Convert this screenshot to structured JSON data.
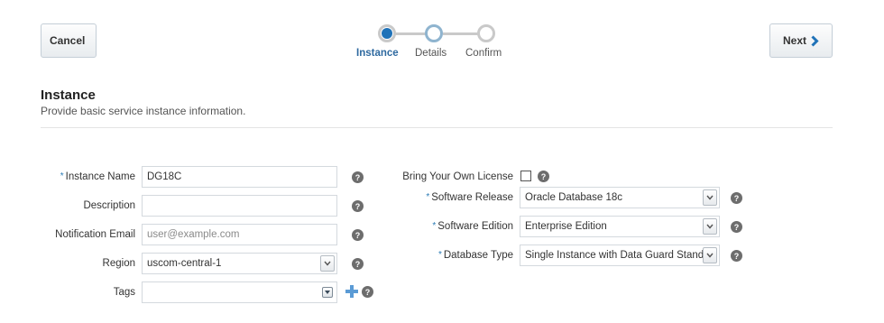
{
  "header": {
    "cancel_label": "Cancel",
    "next_label": "Next"
  },
  "train": {
    "steps": [
      {
        "label": "Instance",
        "state": "current"
      },
      {
        "label": "Details",
        "state": "next"
      },
      {
        "label": "Confirm",
        "state": "upcoming"
      }
    ]
  },
  "section": {
    "title": "Instance",
    "subtitle": "Provide basic service instance information."
  },
  "left_form": {
    "instance_name": {
      "label": "Instance Name",
      "required": "*",
      "value": "DG18C",
      "help": "?"
    },
    "description": {
      "label": "Description",
      "value": "",
      "help": "?"
    },
    "notification_email": {
      "label": "Notification Email",
      "value": "",
      "placeholder": "user@example.com",
      "help": "?"
    },
    "region": {
      "label": "Region",
      "value": "uscom-central-1",
      "help": "?"
    },
    "tags": {
      "label": "Tags",
      "value": "",
      "help": "?"
    }
  },
  "right_form": {
    "byol": {
      "label": "Bring Your Own License",
      "checked": false,
      "help": "?"
    },
    "software_release": {
      "label": "Software Release",
      "required": "*",
      "value": "Oracle Database 18c",
      "help": "?"
    },
    "software_edition": {
      "label": "Software Edition",
      "required": "*",
      "value": "Enterprise Edition",
      "help": "?"
    },
    "database_type": {
      "label": "Database Type",
      "required": "*",
      "value": "Single Instance with Data Guard Standby",
      "help": "?"
    }
  },
  "colors": {
    "accent": "#1f72b8",
    "required_marker": "#2a7bb5",
    "plus_icon": "#5b9bd5"
  },
  "icons": {
    "next": "chevron-right-icon",
    "help": "help-icon",
    "dropdown": "chevron-down-icon",
    "add": "plus-icon"
  }
}
